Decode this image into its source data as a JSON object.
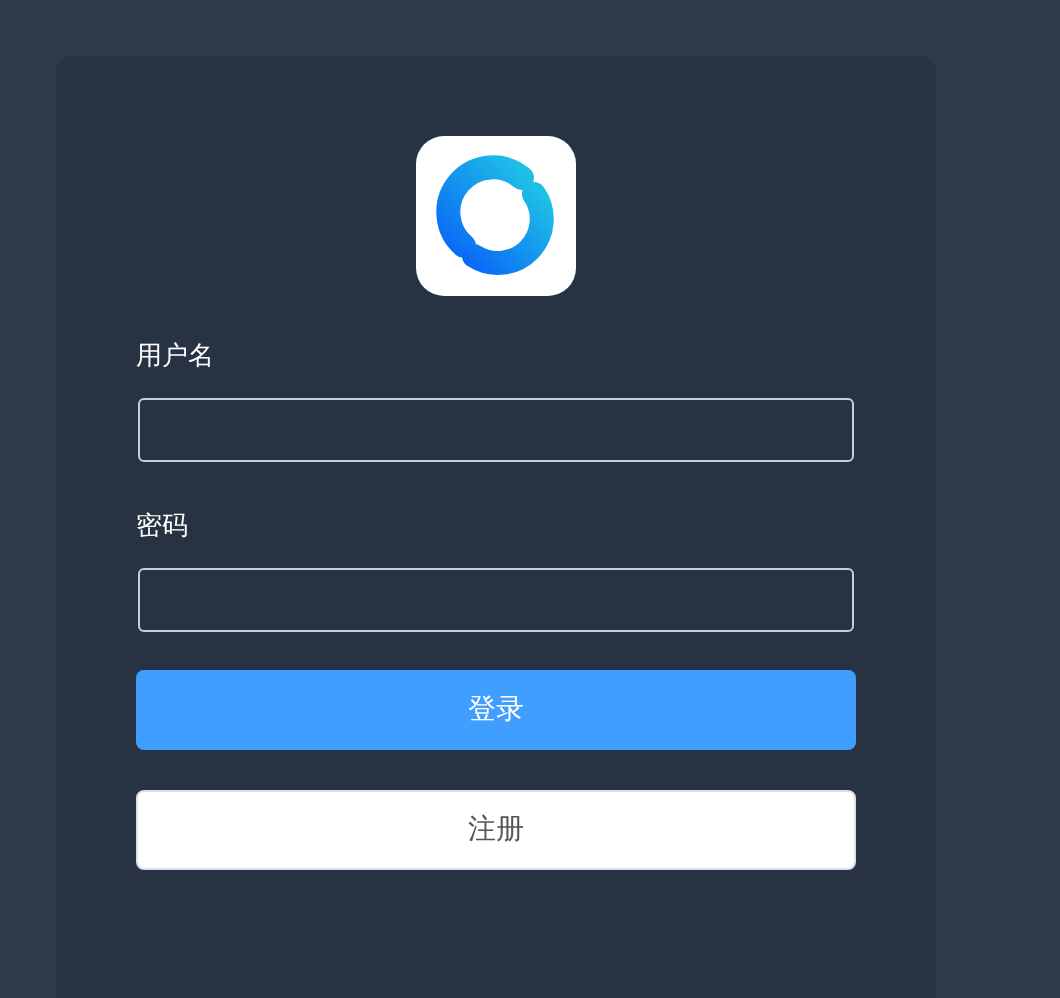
{
  "fields": [
    {
      "label": "用户名"
    },
    {
      "label": "密码"
    }
  ],
  "buttons": [
    {
      "label": "登录",
      "kind": "primary"
    },
    {
      "label": "注册",
      "kind": "default"
    }
  ]
}
